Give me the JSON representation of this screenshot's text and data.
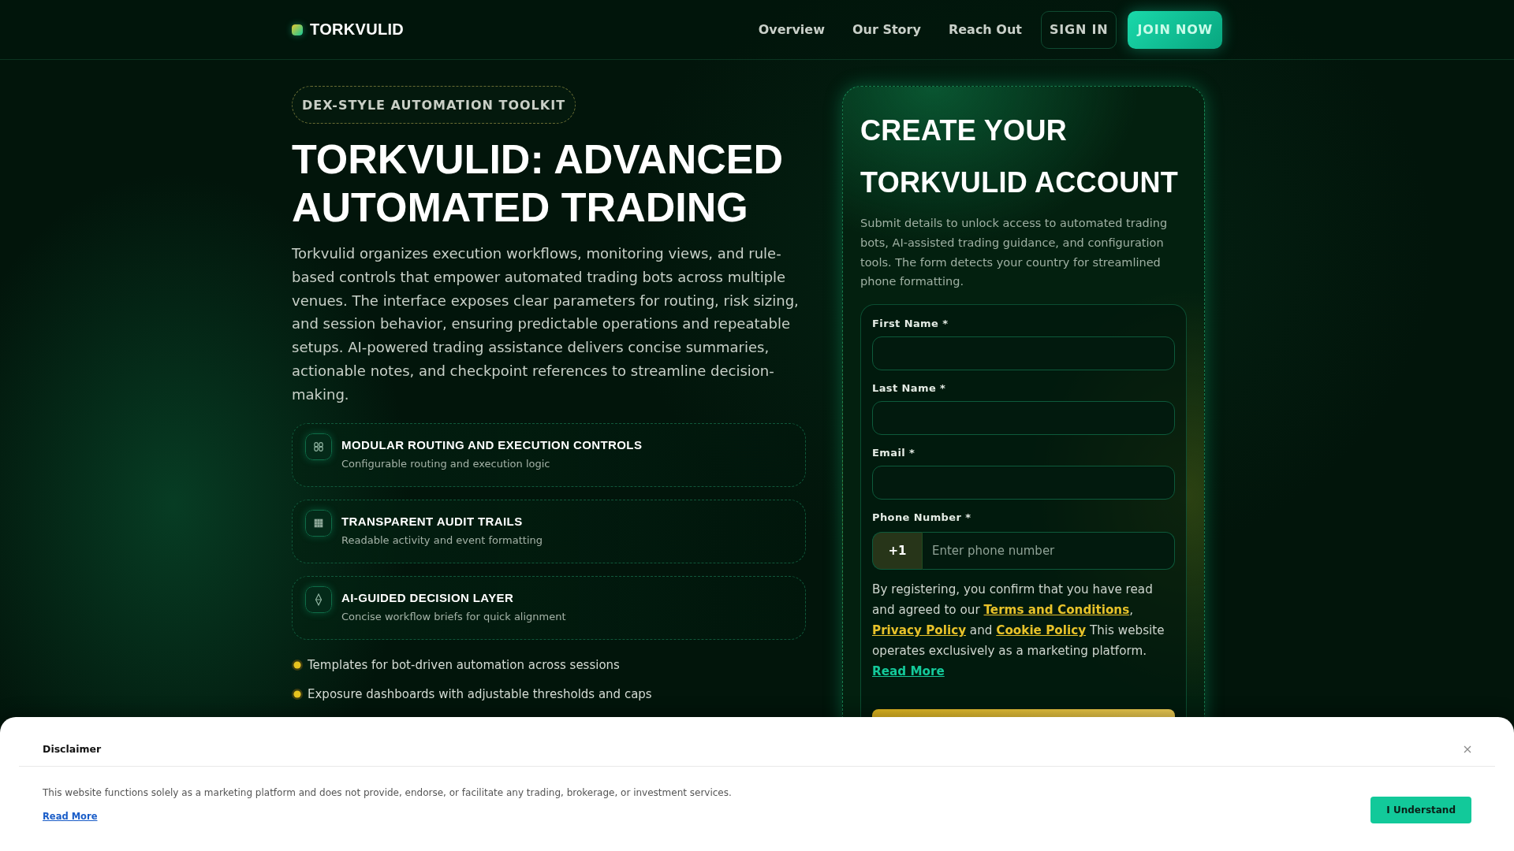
{
  "header": {
    "logo": "TORKVULID",
    "nav": [
      "Overview",
      "Our Story",
      "Reach Out"
    ],
    "sign_in": "SIGN IN",
    "join": "JOIN NOW"
  },
  "hero": {
    "badge": "DEX-STYLE AUTOMATION TOOLKIT",
    "title": "TORKVULID: ADVANCED AUTOMATED TRADING",
    "description": "Torkvulid organizes execution workflows, monitoring views, and rule-based controls that empower automated trading bots across multiple venues. The interface exposes clear parameters for routing, risk sizing, and session behavior, ensuring predictable operations and repeatable setups. AI-powered trading assistance delivers concise summaries, actionable notes, and checkpoint references to streamline decision-making.",
    "features": [
      {
        "title": "MODULAR ROUTING AND EXECUTION CONTROLS",
        "subtitle": "Configurable routing and execution logic"
      },
      {
        "title": "TRANSPARENT AUDIT TRAILS",
        "subtitle": "Readable activity and event formatting"
      },
      {
        "title": "AI-GUIDED DECISION LAYER",
        "subtitle": "Concise workflow briefs for quick alignment"
      }
    ],
    "bullets": [
      "Templates for bot-driven automation across sessions",
      "Exposure dashboards with adjustable thresholds and caps"
    ]
  },
  "signup": {
    "title": "CREATE YOUR TORKVULID ACCOUNT",
    "description": "Submit details to unlock access to automated trading bots, AI-assisted trading guidance, and configuration tools. The form detects your country for streamlined phone formatting.",
    "fields": [
      {
        "kind": "text",
        "label": "First Name *"
      },
      {
        "kind": "text",
        "label": "Last Name *"
      },
      {
        "kind": "text",
        "label": "Email *"
      },
      {
        "kind": "phone",
        "label": "Phone Number *",
        "prefix": "+1",
        "placeholder": "Enter phone number"
      }
    ],
    "consent": [
      {
        "kind": "plain",
        "text": "By registering, you confirm that you have read and agreed to our "
      },
      {
        "kind": "link",
        "text": "Terms and Conditions"
      },
      {
        "kind": "plain",
        "text": ", "
      },
      {
        "kind": "link",
        "text": "Privacy Policy"
      },
      {
        "kind": "plain",
        "text": " and "
      },
      {
        "kind": "link",
        "text": "Cookie Policy"
      },
      {
        "kind": "plain",
        "text": " This website operates exclusively as a marketing platform. "
      },
      {
        "kind": "more",
        "text": "Read More"
      }
    ]
  },
  "disclaimer": {
    "title": "Disclaimer",
    "text": "This website functions solely as a marketing platform and does not provide, endorse, or facilitate any trading, brokerage, or investment services.",
    "link": "Read More",
    "button": "I Understand"
  }
}
